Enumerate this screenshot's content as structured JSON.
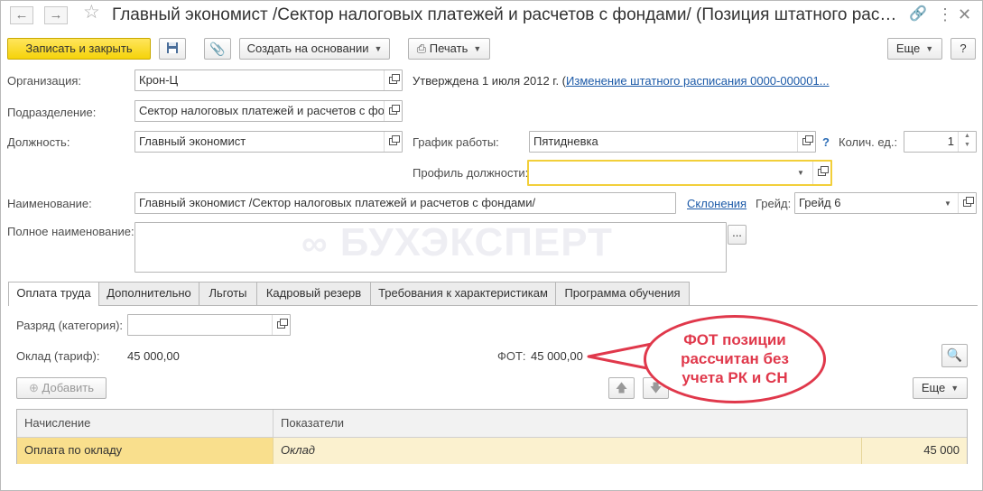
{
  "window": {
    "title": "Главный экономист /Сектор налоговых платежей и расчетов с фондами/ (Позиция штатного расп...",
    "back_icon": "arrow-left-icon",
    "forward_icon": "arrow-right-icon",
    "favorite_icon": "star-icon",
    "link_icon": "link-icon",
    "menu_icon": "more-vertical-icon",
    "close_icon": "close-icon"
  },
  "toolbar": {
    "save_close_label": "Записать и закрыть",
    "create_based_label": "Создать на основании",
    "print_label": "Печать",
    "more_label": "Еще",
    "help_label": "?"
  },
  "form": {
    "organization_label": "Организация:",
    "organization_value": "Крон-Ц",
    "approved_text": "Утверждена 1 июля 2012 г. (",
    "approved_link": "Изменение штатного расписания 0000-000001...",
    "department_label": "Подразделение:",
    "department_value": "Сектор налоговых платежей и расчетов с фо",
    "position_label": "Должность:",
    "position_value": "Главный экономист",
    "schedule_label": "График работы:",
    "schedule_value": "Пятидневка",
    "schedule_help": "?",
    "units_label": "Колич. ед.:",
    "units_value": "1",
    "profile_label": "Профиль должности:",
    "profile_value": "",
    "name_label": "Наименование:",
    "name_value": "Главный экономист /Сектор налоговых платежей и расчетов с фондами/",
    "declension_link": "Склонения",
    "grade_label": "Грейд:",
    "grade_value": "Грейд 6",
    "full_name_label": "Полное наименование:",
    "full_name_value": "",
    "ellipsis_button": "..."
  },
  "watermark": "БУХЭКСПЕРТ",
  "tabs": [
    {
      "label": "Оплата труда"
    },
    {
      "label": "Дополнительно"
    },
    {
      "label": "Льготы"
    },
    {
      "label": "Кадровый резерв"
    },
    {
      "label": "Требования к характеристикам"
    },
    {
      "label": "Программа обучения"
    }
  ],
  "pay": {
    "category_label": "Разряд (категория):",
    "category_value": "",
    "salary_label": "Оклад (тариф):",
    "salary_value": "45 000,00",
    "fot_label": "ФОТ:",
    "fot_value": "45 000,00",
    "add_label": "Добавить",
    "more_label": "Еще"
  },
  "callout": {
    "line1": "ФОТ позиции",
    "line2": "рассчитан без",
    "line3": "учета РК и СН"
  },
  "table": {
    "columns": [
      "Начисление",
      "Показатели"
    ],
    "rows": [
      {
        "accrual": "Оплата по окладу",
        "indicator": "Оклад",
        "amount": "45 000"
      }
    ]
  },
  "colors": {
    "primary_button": "#f5d30a",
    "callout": "#e0384b",
    "selected_row": "#f9df8d",
    "link": "#1c5aa8"
  }
}
